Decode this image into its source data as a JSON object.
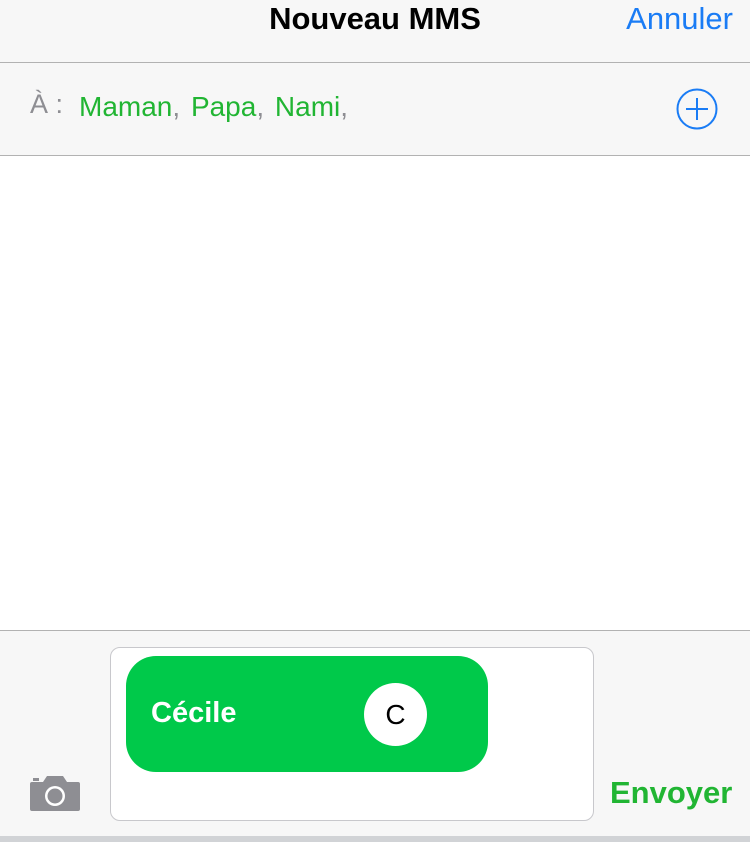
{
  "header": {
    "title": "Nouveau MMS",
    "cancel_label": "Annuler"
  },
  "recipients": {
    "label": "À :",
    "items": [
      {
        "name": "Maman",
        "sep": ","
      },
      {
        "name": "Papa",
        "sep": ","
      },
      {
        "name": "Nami",
        "sep": ","
      }
    ],
    "add_icon": "plus-circle-icon"
  },
  "compose": {
    "contact_chip": {
      "name": "Cécile",
      "avatar_initial": "C"
    },
    "camera_icon": "camera-icon",
    "send_label": "Envoyer"
  },
  "colors": {
    "accent_blue": "#1a7cf5",
    "recipient_green": "#21b533",
    "chip_green": "#00c94a",
    "bar_background": "#f7f7f7"
  }
}
